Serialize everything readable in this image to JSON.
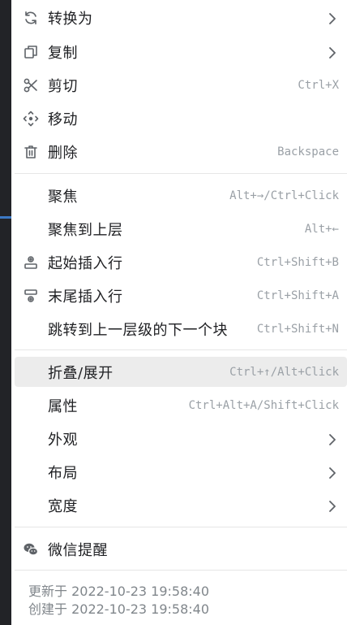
{
  "menu": {
    "items": [
      {
        "label": "转换为",
        "icon": "refresh-icon",
        "submenu": true
      },
      {
        "label": "复制",
        "icon": "copy-icon",
        "submenu": true
      },
      {
        "label": "剪切",
        "icon": "scissors-icon",
        "shortcut": "Ctrl+X"
      },
      {
        "label": "移动",
        "icon": "move-icon"
      },
      {
        "label": "删除",
        "icon": "trash-icon",
        "shortcut": "Backspace"
      },
      {
        "label": "聚焦",
        "shortcut": "Alt+→/Ctrl+Click"
      },
      {
        "label": "聚焦到上层",
        "shortcut": "Alt+←"
      },
      {
        "label": "起始插入行",
        "icon": "insert-before-icon",
        "shortcut": "Ctrl+Shift+B"
      },
      {
        "label": "末尾插入行",
        "icon": "insert-after-icon",
        "shortcut": "Ctrl+Shift+A"
      },
      {
        "label": "跳转到上一层级的下一个块",
        "shortcut": "Ctrl+Shift+N"
      },
      {
        "label": "折叠/展开",
        "shortcut": "Ctrl+↑/Alt+Click",
        "highlighted": true
      },
      {
        "label": "属性",
        "shortcut": "Ctrl+Alt+A/Shift+Click"
      },
      {
        "label": "外观",
        "submenu": true
      },
      {
        "label": "布局",
        "submenu": true
      },
      {
        "label": "宽度",
        "submenu": true
      },
      {
        "label": "微信提醒",
        "icon": "wechat-icon"
      }
    ]
  },
  "footer": {
    "updated": "更新于 2022-10-23 19:58:40",
    "created": "创建于 2022-10-23 19:58:40"
  },
  "colors": {
    "menu_bg": "#ffffff",
    "hover_bg": "#ececec",
    "shortcut_text": "#9aa0a6",
    "dark_bg": "#2b2d31",
    "accent": "#3b78c4"
  }
}
